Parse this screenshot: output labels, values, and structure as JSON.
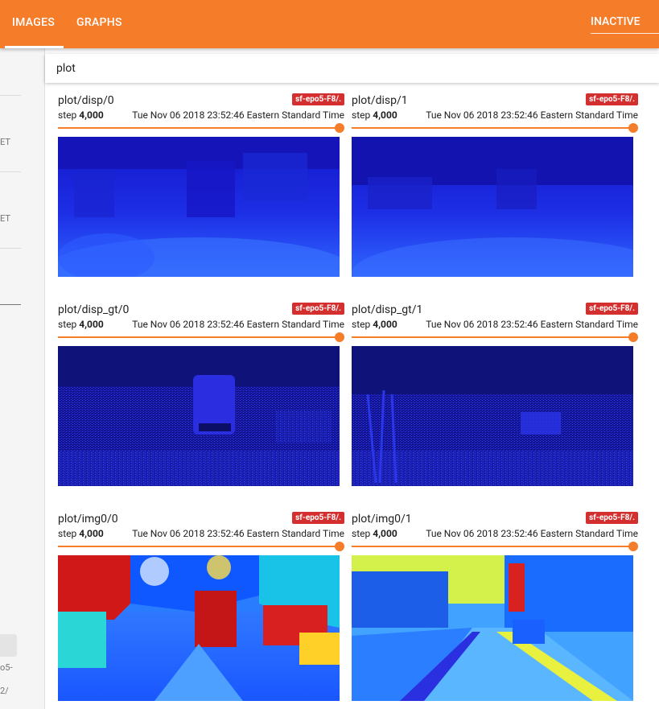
{
  "header": {
    "tabs": [
      {
        "label": "IMAGES",
        "active": true
      },
      {
        "label": "GRAPHS",
        "active": false
      }
    ],
    "status": "INACTIVE"
  },
  "sidebar": {
    "fragments": [
      "ET",
      "ET",
      "o5-",
      "2/"
    ]
  },
  "search": {
    "value": "plot"
  },
  "cards": [
    {
      "title": "plot/disp/0",
      "run": "sf-epo5-F8/.",
      "step_label": "step",
      "step": "4,000",
      "time": "Tue Nov 06 2018 23:52:46 Eastern Standard Time"
    },
    {
      "title": "plot/disp/1",
      "run": "sf-epo5-F8/.",
      "step_label": "step",
      "step": "4,000",
      "time": "Tue Nov 06 2018 23:52:46 Eastern Standard Time"
    },
    {
      "title": "plot/disp_gt/0",
      "run": "sf-epo5-F8/.",
      "step_label": "step",
      "step": "4,000",
      "time": "Tue Nov 06 2018 23:52:46 Eastern Standard Time"
    },
    {
      "title": "plot/disp_gt/1",
      "run": "sf-epo5-F8/.",
      "step_label": "step",
      "step": "4,000",
      "time": "Tue Nov 06 2018 23:52:46 Eastern Standard Time"
    },
    {
      "title": "plot/img0/0",
      "run": "sf-epo5-F8/.",
      "step_label": "step",
      "step": "4,000",
      "time": "Tue Nov 06 2018 23:52:46 Eastern Standard Time"
    },
    {
      "title": "plot/img0/1",
      "run": "sf-epo5-F8/.",
      "step_label": "step",
      "step": "4,000",
      "time": "Tue Nov 06 2018 23:52:46 Eastern Standard Time"
    }
  ],
  "colors": {
    "header": "#f57c28",
    "badge": "#d32f2f",
    "slider": "#f57c28"
  }
}
